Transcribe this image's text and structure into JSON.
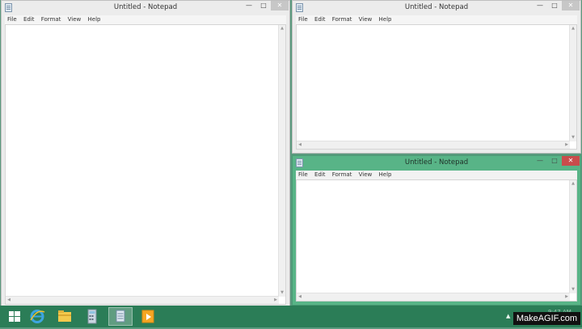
{
  "windows": [
    {
      "title": "Untitled - Notepad",
      "menu": [
        "File",
        "Edit",
        "Format",
        "View",
        "Help"
      ]
    },
    {
      "title": "Untitled - Notepad",
      "menu": [
        "File",
        "Edit",
        "Format",
        "View",
        "Help"
      ]
    },
    {
      "title": "Untitled - Notepad",
      "menu": [
        "File",
        "Edit",
        "Format",
        "View",
        "Help"
      ],
      "active": true
    }
  ],
  "controls": {
    "minimize": "—",
    "maximize": "□",
    "close": "✕"
  },
  "taskbar": {
    "apps": [
      "start-icon",
      "internet-explorer-icon",
      "file-explorer-icon",
      "calculator-icon",
      "notepad-icon",
      "media-player-icon"
    ],
    "tray_text": "9:47 AM"
  },
  "watermark": "MakeAGIF.com",
  "colors": {
    "active_title": "#58b487",
    "active_close": "#c94c4c",
    "taskbar": "#2b7d57"
  }
}
